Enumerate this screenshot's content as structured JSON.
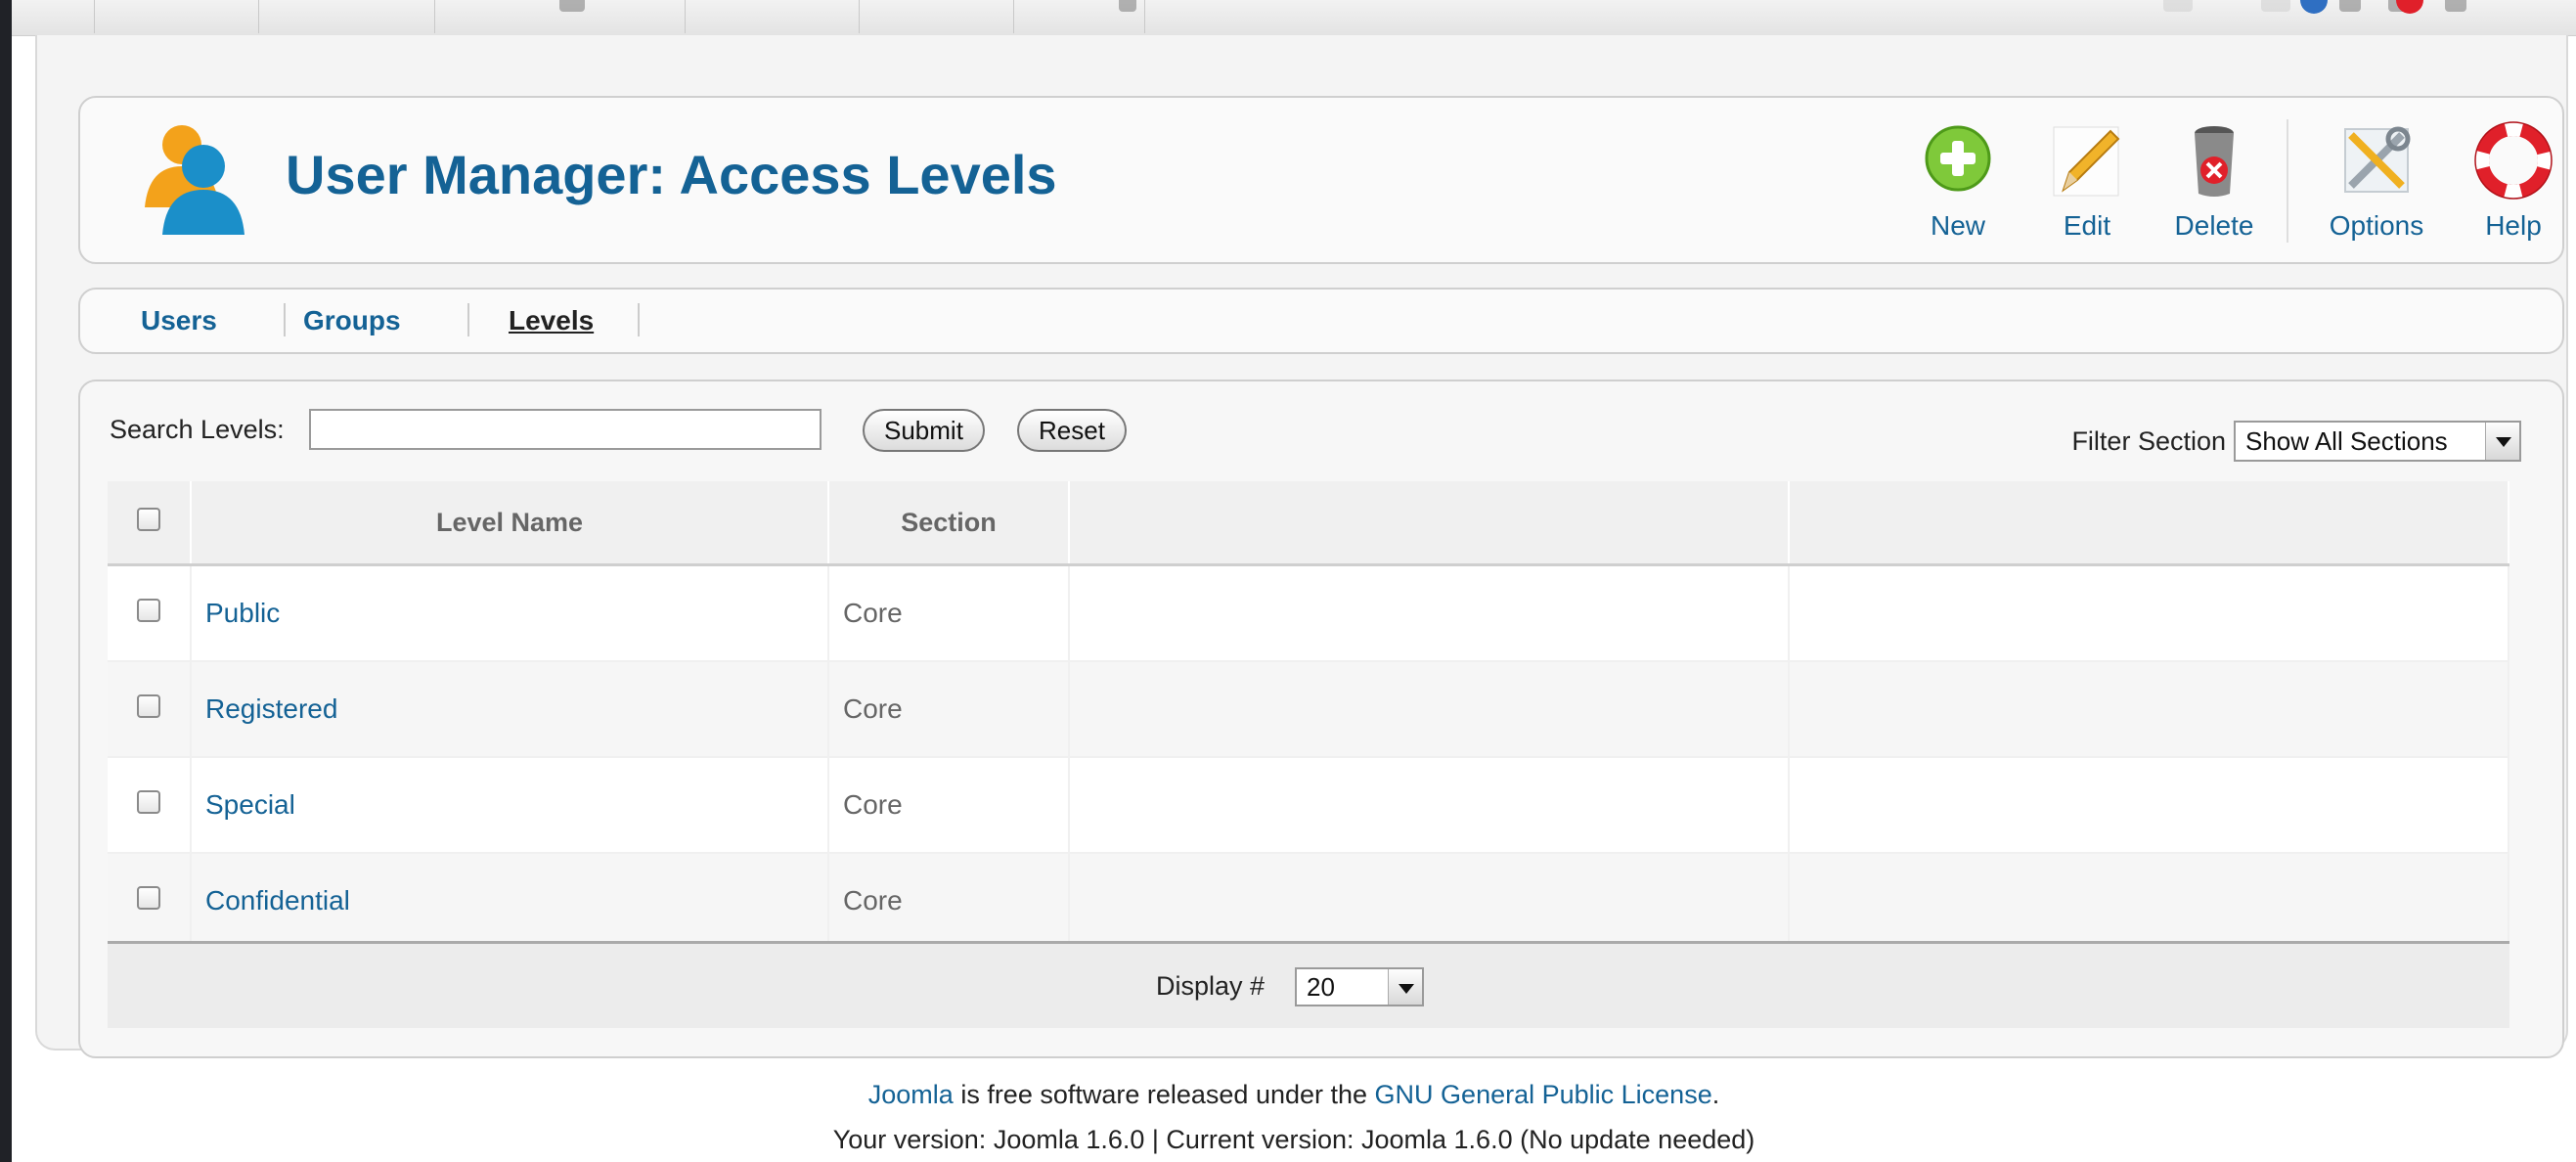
{
  "header": {
    "title": "User Manager: Access Levels",
    "icon": "users-icon",
    "toolbar": [
      {
        "label": "New",
        "icon": "new-plus-icon"
      },
      {
        "label": "Edit",
        "icon": "edit-pencil-icon"
      },
      {
        "label": "Delete",
        "icon": "delete-trash-icon"
      },
      {
        "label": "Options",
        "icon": "options-tools-icon"
      },
      {
        "label": "Help",
        "icon": "help-lifebuoy-icon"
      }
    ]
  },
  "tabs": [
    {
      "label": "Users",
      "active": false
    },
    {
      "label": "Groups",
      "active": false
    },
    {
      "label": "Levels",
      "active": true
    }
  ],
  "search": {
    "label": "Search Levels:",
    "value": "",
    "placeholder": "",
    "submit_label": "Submit",
    "reset_label": "Reset"
  },
  "filter": {
    "label": "Filter Section",
    "selected": "Show All Sections"
  },
  "table": {
    "columns": [
      "",
      "Level Name",
      "Section",
      "",
      ""
    ],
    "rows": [
      {
        "name": "Public",
        "section": "Core"
      },
      {
        "name": "Registered",
        "section": "Core"
      },
      {
        "name": "Special",
        "section": "Core"
      },
      {
        "name": "Confidential",
        "section": "Core"
      }
    ]
  },
  "pagination": {
    "display_label": "Display #",
    "display_value": "20"
  },
  "footer": {
    "joomla_link": "Joomla",
    "license_text_1": " is free software released under the ",
    "license_link": "GNU General Public License",
    "license_text_2": ".",
    "version_text": "Your version: Joomla 1.6.0 | Current version: Joomla 1.6.0 (No update needed)"
  },
  "colors": {
    "link_blue": "#146295",
    "background_dark": "#202227"
  }
}
